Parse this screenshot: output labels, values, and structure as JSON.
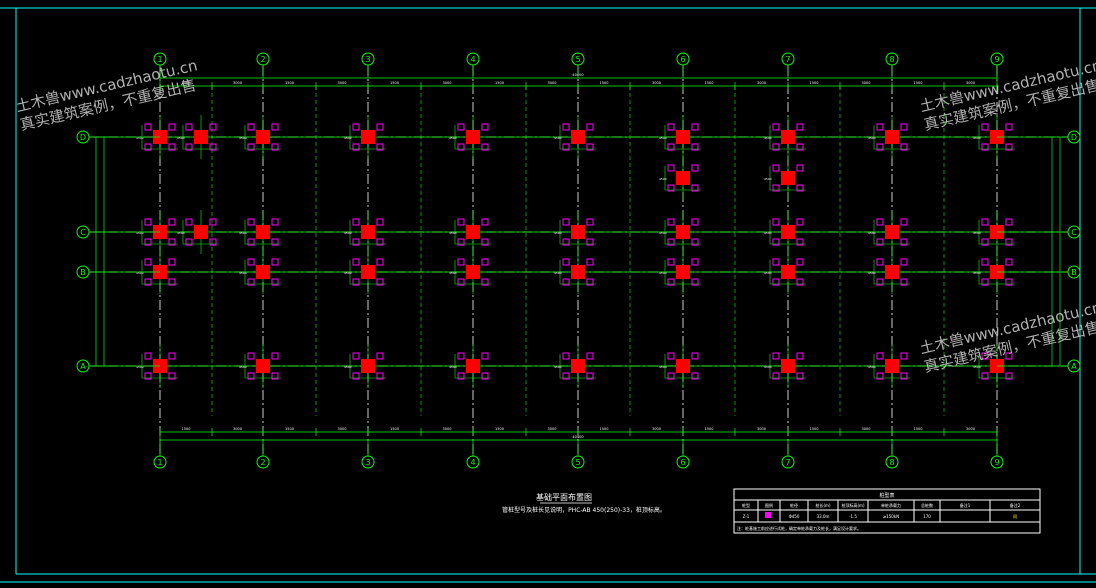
{
  "watermark": {
    "line1": "土木兽www.cadzhaotu.cn",
    "line2": "真实建筑案例，不重复出售"
  },
  "axes": {
    "numbers": [
      "1",
      "2",
      "3",
      "4",
      "5",
      "6",
      "7",
      "8",
      "9"
    ],
    "letters": [
      "D",
      "C",
      "B",
      "A"
    ]
  },
  "drawing": {
    "title": "基础平面布置图",
    "note": "管桩型号及桩长见说明，PHC-AB 450(250)-33，桩顶标高。"
  },
  "dimensions": {
    "total": "40400",
    "bay": "4500",
    "half_a": "1500",
    "half_b": "3000"
  },
  "legend": {
    "title": "桩型表",
    "headers": [
      "桩型",
      "图例",
      "桩径",
      "桩长(m)",
      "桩顶标高(m)",
      "单桩承载力",
      "总桩数",
      "备注1",
      "备注2"
    ],
    "row": [
      "Z-1",
      "",
      "Φ450",
      "33.0m",
      "-1.5",
      "≥150kN",
      "170",
      "",
      "同"
    ],
    "note": "注：桩基施工前应进行试桩，确定单桩承载力及桩长，满足设计要求。"
  },
  "colors": {
    "background": "#000000",
    "grid_line": "#00ff00",
    "axis_dash": "#ffffff",
    "pile_cap": "#ff0000",
    "pile": "#ff00ff",
    "frame": "#00ffff",
    "dim_text": "#ffffff"
  }
}
